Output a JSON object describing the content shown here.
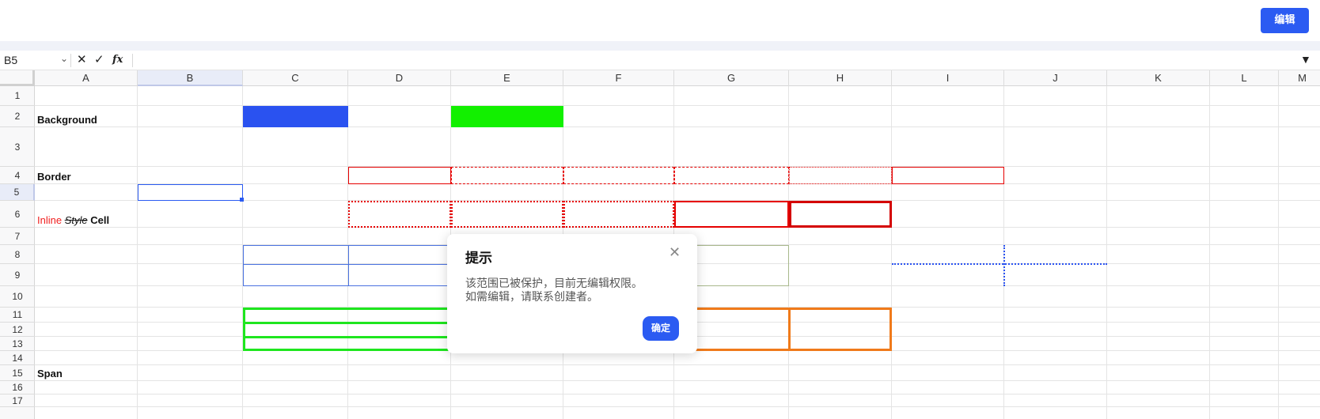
{
  "header": {
    "edit_label": "编辑"
  },
  "formula_bar": {
    "cell_ref": "B5",
    "namebox_caret": "⌄",
    "cancel_glyph": "✕",
    "confirm_glyph": "✓",
    "fx_glyph": "fx",
    "expand_glyph": "▼",
    "value": ""
  },
  "columns": [
    "A",
    "B",
    "C",
    "D",
    "E",
    "F",
    "G",
    "H",
    "I",
    "J",
    "K",
    "L",
    "M"
  ],
  "rows": [
    "1",
    "2",
    "3",
    "4",
    "5",
    "6",
    "7",
    "8",
    "9",
    "10",
    "11",
    "12",
    "13",
    "14",
    "15",
    "16",
    "17"
  ],
  "selected_cell": {
    "column": "B",
    "row": "5"
  },
  "cell_labels": {
    "background": "Background",
    "border": "Border",
    "inline_red": "Inline",
    "inline_strike": "Style",
    "inline_rest": "Cell",
    "span": "Span"
  },
  "colors": {
    "blue_fill": "#2a52f0",
    "green_fill": "#12f000",
    "red_border": "#e60000",
    "green_border": "#1ee61e",
    "orange_border": "#f07a1a",
    "blue_border": "#4a72e0",
    "accent": "#2b5bf2"
  },
  "dialog": {
    "title": "提示",
    "close_glyph": "✕",
    "line1": "该范围已被保护，目前无编辑权限。",
    "line2": "如需编辑，请联系创建者。",
    "ok_label": "确定"
  }
}
